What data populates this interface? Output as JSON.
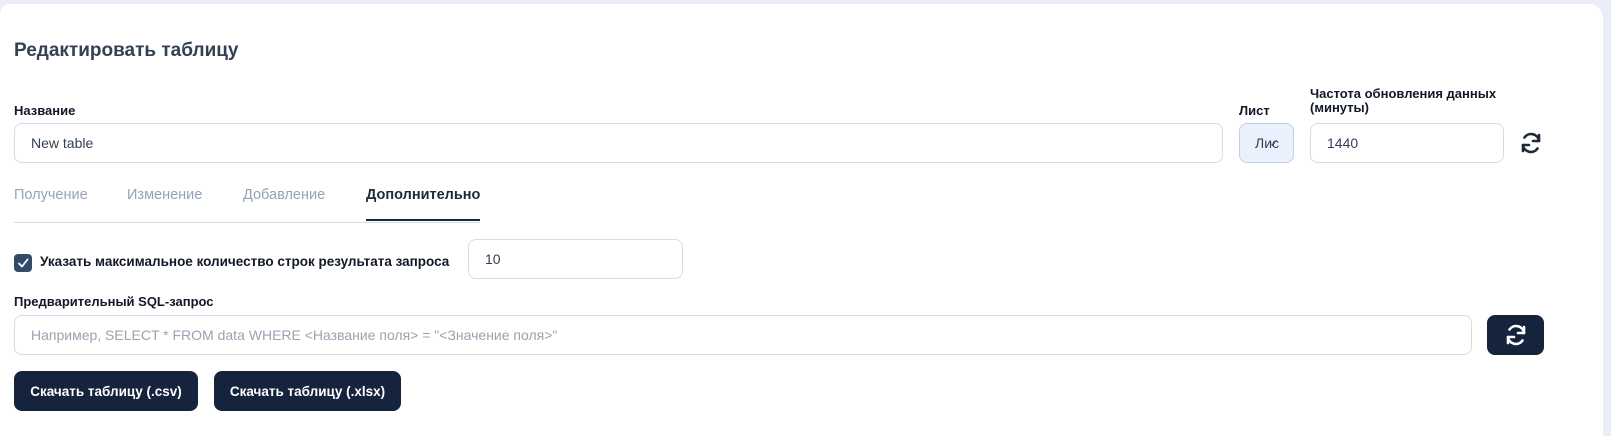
{
  "form": {
    "title": "Редактировать таблицу",
    "name_label": "Название",
    "name_value": "New table",
    "sheet_label": "Лист",
    "sheet_value": "Лис",
    "frequency_label_line1": "Частота обновления данных",
    "frequency_label_line2": "(минуты)",
    "frequency_value": "1440"
  },
  "tabs": [
    {
      "label": "Получение",
      "active": false
    },
    {
      "label": "Изменение",
      "active": false
    },
    {
      "label": "Добавление",
      "active": false
    },
    {
      "label": "Дополнительно",
      "active": true
    }
  ],
  "advanced": {
    "max_rows_checked": true,
    "max_rows_label": "Указать максимальное количество строк результата запроса",
    "max_rows_value": "10",
    "sql_label": "Предварительный SQL-запрос",
    "sql_placeholder": "Например, SELECT * FROM data WHERE <Название поля> = \"<Значение поля>\"",
    "sql_value": ""
  },
  "buttons": {
    "download_csv": "Скачать таблицу (.csv)",
    "download_xlsx": "Скачать таблицу (.xlsx)"
  },
  "icons": {
    "refresh": "refresh-icon",
    "check": "check-icon",
    "chevron": "chevron-down-icon"
  },
  "colors": {
    "primary_dark": "#15233d",
    "checkbox": "#334a6b",
    "select_bg": "#eaf1fd",
    "muted_tab": "#94a3b8"
  }
}
